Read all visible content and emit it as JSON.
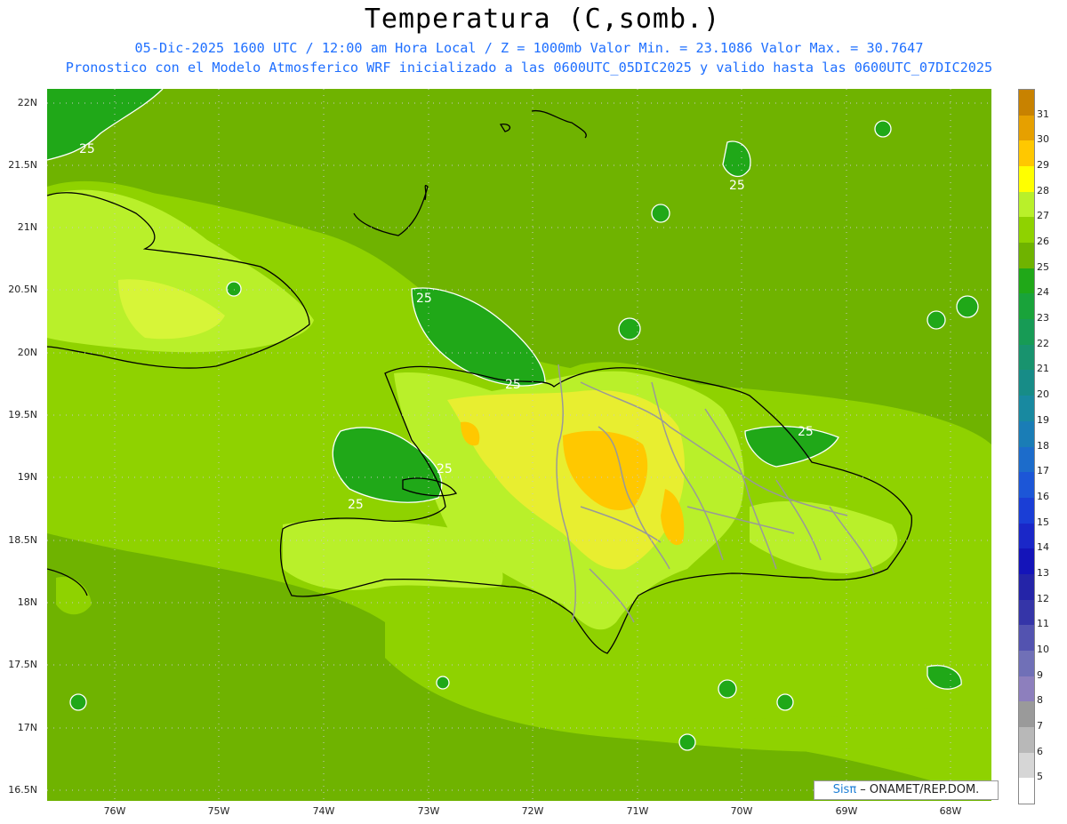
{
  "header": {
    "title": "Temperatura (C,somb.)",
    "subtitle1": "05-Dic-2025 1600 UTC / 12:00 am Hora Local / Z = 1000mb  Valor Min. = 23.1086  Valor Max. = 30.7647",
    "subtitle2": "Pronostico con el Modelo Atmosferico WRF inicializado a las 0600UTC_05DIC2025 y valido hasta las  0600UTC_07DIC2025"
  },
  "axes": {
    "lat_labels": [
      "22N",
      "21.5N",
      "21N",
      "20.5N",
      "20N",
      "19.5N",
      "19N",
      "18.5N",
      "18N",
      "17.5N",
      "17N",
      "16.5N"
    ],
    "lon_labels": [
      "76W",
      "75W",
      "74W",
      "73W",
      "72W",
      "71W",
      "70W",
      "69W",
      "68W"
    ]
  },
  "contour_label": "25",
  "credit": {
    "brand": "SisPi",
    "brand_symbol": "Sisπ",
    "rest": " –  ONAMET/REP.DOM."
  },
  "colorbar": {
    "labels": [
      "31",
      "30",
      "29",
      "28",
      "27",
      "26",
      "25",
      "24",
      "23",
      "22",
      "21",
      "20",
      "19",
      "18",
      "17",
      "16",
      "15",
      "14",
      "13",
      "12",
      "11",
      "10",
      "9",
      "8",
      "7",
      "6",
      "5"
    ],
    "colors": [
      "#c88200",
      "#e6a000",
      "#ffc800",
      "#ffff00",
      "#b9f02a",
      "#8fd200",
      "#6fb300",
      "#20a818",
      "#19a33a",
      "#179b55",
      "#18936e",
      "#178c87",
      "#1889a0",
      "#1a7db6",
      "#1c6ccb",
      "#1c56d7",
      "#1a3ed6",
      "#1a27c8",
      "#1414b9",
      "#2424a8",
      "#3535a8",
      "#5353b0",
      "#7070b7",
      "#8d7fbd",
      "#9a9a9a",
      "#b8b8b8",
      "#d6d6d6",
      "#ffffff"
    ]
  },
  "colors": {
    "background_field": "#6fb300",
    "coast": "#000000",
    "border": "#999999",
    "contour": "#ffffff",
    "subtitle": "#1f6fff"
  }
}
